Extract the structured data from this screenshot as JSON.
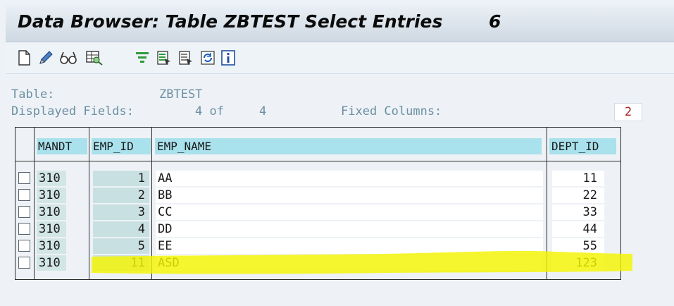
{
  "window": {
    "title": "Data Browser: Table ZBTEST Select Entries",
    "entry_count": "6"
  },
  "toolbar": {
    "icons": [
      "new-document-icon",
      "edit-pencil-icon",
      "display-glasses-icon",
      "check-table-icon",
      "filter-icon",
      "select-fields-icon",
      "print-list-icon",
      "refresh-icon",
      "info-icon"
    ]
  },
  "info": {
    "table_label": "Table:",
    "table_value": "ZBTEST",
    "displayed_label": "Displayed Fields:",
    "displayed_value": "4 of",
    "displayed_total": "4",
    "fixed_label": "Fixed Columns:",
    "fixed_value": "2"
  },
  "columns": [
    "MANDT",
    "EMP_ID",
    "EMP_NAME",
    "DEPT_ID"
  ],
  "rows": [
    {
      "mandt": "310",
      "emp_id": "1",
      "emp_name": "AA",
      "dept_id": "11"
    },
    {
      "mandt": "310",
      "emp_id": "2",
      "emp_name": "BB",
      "dept_id": "22"
    },
    {
      "mandt": "310",
      "emp_id": "3",
      "emp_name": "CC",
      "dept_id": "33"
    },
    {
      "mandt": "310",
      "emp_id": "4",
      "emp_name": "DD",
      "dept_id": "44"
    },
    {
      "mandt": "310",
      "emp_id": "5",
      "emp_name": "EE",
      "dept_id": "55"
    },
    {
      "mandt": "310",
      "emp_id": "11",
      "emp_name": "ASD",
      "dept_id": "123"
    }
  ],
  "colors": {
    "highlight": "#f4f400",
    "header_bg": "#a9e1ec",
    "fixed_col_bg": "#d3e6e6"
  }
}
